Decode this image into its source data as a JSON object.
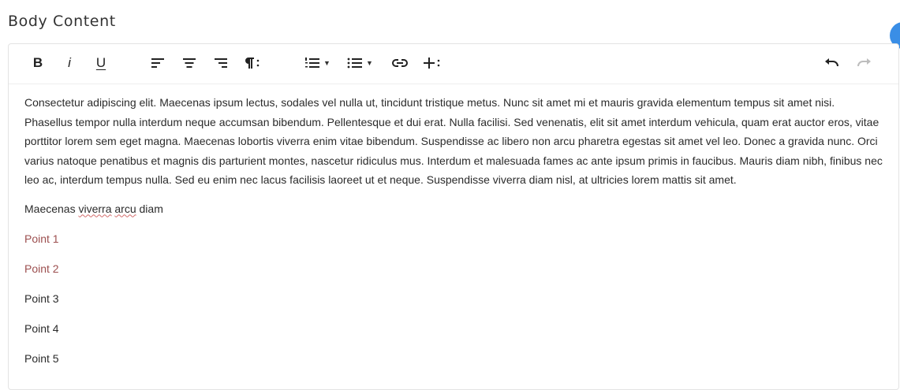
{
  "section": {
    "title": "Body Content"
  },
  "toolbar": {
    "bold_label": "B",
    "italic_label": "i",
    "underline_label": "U",
    "icons": [
      "align-left-icon",
      "align-center-icon",
      "align-right-icon",
      "paragraph-format-icon",
      "ordered-list-icon",
      "unordered-list-icon",
      "link-icon",
      "insert-more-icon",
      "undo-icon",
      "redo-icon"
    ]
  },
  "content": {
    "paragraph": "Consectetur adipiscing elit. Maecenas ipsum lectus, sodales vel nulla ut, tincidunt tristique metus. Nunc sit amet mi et mauris gravida elementum tempus sit amet nisi. Phasellus tempor nulla interdum neque accumsan bibendum. Pellentesque et dui erat. Nulla facilisi. Sed venenatis, elit sit amet interdum vehicula, quam erat auctor eros, vitae porttitor lorem sem eget magna. Maecenas lobortis viverra enim vitae bibendum. Suspendisse ac libero non arcu pharetra egestas sit amet vel leo. Donec a gravida nunc. Orci varius natoque penatibus et magnis dis parturient montes, nascetur ridiculus mus. Interdum et malesuada fames ac ante ipsum primis in faucibus. Mauris diam nibh, finibus nec leo ac, interdum tempus nulla. Sed eu enim nec lacus facilisis laoreet ut et neque. Suspendisse viverra diam nisl, at ultricies lorem mattis sit amet.",
    "heading_line": {
      "word1": "Maecenas",
      "word2": "viverra",
      "word3": "arcu",
      "word4": "diam"
    },
    "points": [
      "Point 1",
      "Point 2",
      "Point 3",
      "Point 4",
      "Point 5"
    ]
  },
  "colors": {
    "accent": "#3a8ee6",
    "highlighted_text": "#9c4f4f",
    "spellcheck": "#d36b6b"
  }
}
